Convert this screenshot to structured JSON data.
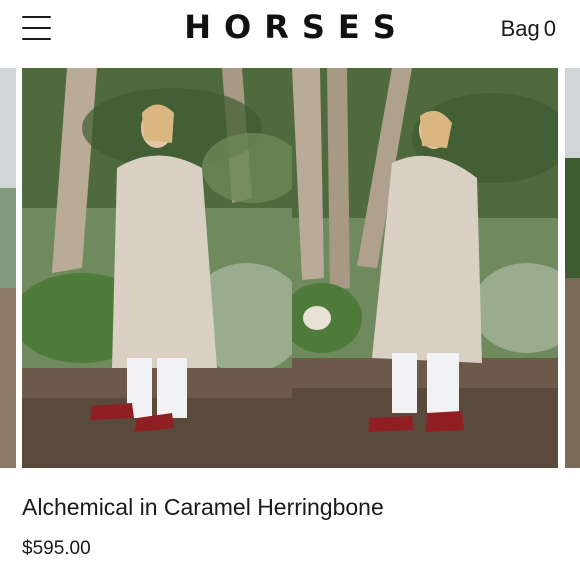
{
  "header": {
    "menu_icon": "hamburger-menu-icon",
    "logo_text": "HORSES",
    "bag_label": "Bag",
    "bag_count": "0"
  },
  "gallery": {
    "images": [
      {
        "semantic": "product-photo-front",
        "alt": "Model wearing long oatmeal coat, front view"
      },
      {
        "semantic": "product-photo-side",
        "alt": "Model wearing long oatmeal coat, side view"
      }
    ]
  },
  "product": {
    "title": "Alchemical in Caramel Herringbone",
    "price": "$595.00"
  },
  "colors": {
    "coat": "#d9d0c3",
    "boots": "#8f1f22",
    "foliage": "#5a7a45",
    "ground": "#6b5a4a",
    "trunk": "#b9ab98"
  }
}
